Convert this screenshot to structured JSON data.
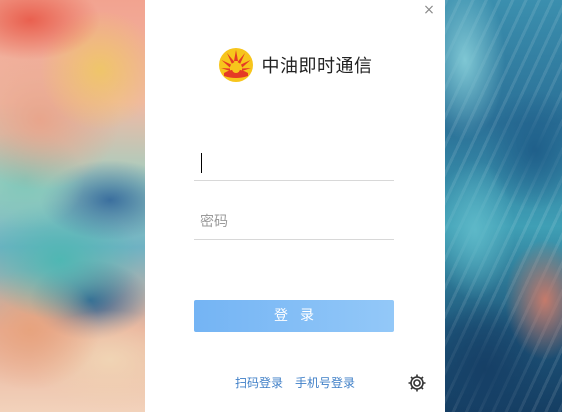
{
  "window": {
    "close_symbol": "×"
  },
  "header": {
    "logo_icon": "petrochina-logo-icon",
    "title": "中油即时通信"
  },
  "form": {
    "account": {
      "value": "",
      "placeholder": ""
    },
    "password": {
      "value": "",
      "placeholder": "密码"
    },
    "login_label": "登录"
  },
  "footer": {
    "scan_login_label": "扫码登录",
    "phone_login_label": "手机号登录",
    "settings_icon": "gear-icon"
  },
  "colors": {
    "login_button": "#74b4f4",
    "link": "#3f7fc7",
    "logo_red": "#e53a25",
    "logo_yellow": "#f7c51c"
  }
}
